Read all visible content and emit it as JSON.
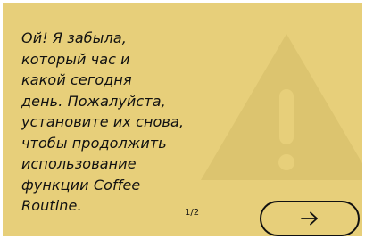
{
  "screen": {
    "message": "Ой! Я забыла,\nкоторый час и\nкакой сегодня\nдень. Пожалуйста,\nустановите их снова,\nчтобы продолжить\nиспользование\nфункции Coffee\nRoutine.",
    "page_indicator": "1/2",
    "next_button_icon": "arrow-right-icon",
    "background_icon": "warning-triangle-icon"
  },
  "colors": {
    "background": "#e7cf7a",
    "warning_icon": "#dcc46f",
    "text": "#111111"
  }
}
